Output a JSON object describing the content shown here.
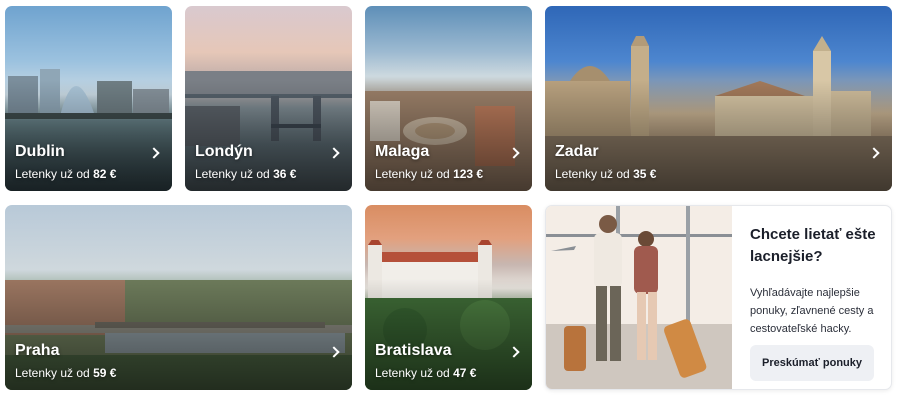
{
  "destinations": [
    {
      "id": "dublin",
      "city": "Dublin",
      "price_prefix": "Letenky už od",
      "price": "82 €"
    },
    {
      "id": "londyn",
      "city": "Londýn",
      "price_prefix": "Letenky už od",
      "price": "36 €"
    },
    {
      "id": "malaga",
      "city": "Malaga",
      "price_prefix": "Letenky už od",
      "price": "123 €"
    },
    {
      "id": "zadar",
      "city": "Zadar",
      "price_prefix": "Letenky už od",
      "price": "35 €"
    },
    {
      "id": "praha",
      "city": "Praha",
      "price_prefix": "Letenky už od",
      "price": "59 €"
    },
    {
      "id": "bratislava",
      "city": "Bratislava",
      "price_prefix": "Letenky už od",
      "price": "47 €"
    }
  ],
  "promo": {
    "title": "Chcete lietať ešte lacnejšie?",
    "text": "Vyhľadávajte najlepšie ponuky, zľavnené cesty a cestovateľské hacky.",
    "button_label": "Preskúmať ponuky"
  },
  "icons": {
    "card_arrow": "chevron-right-icon"
  }
}
